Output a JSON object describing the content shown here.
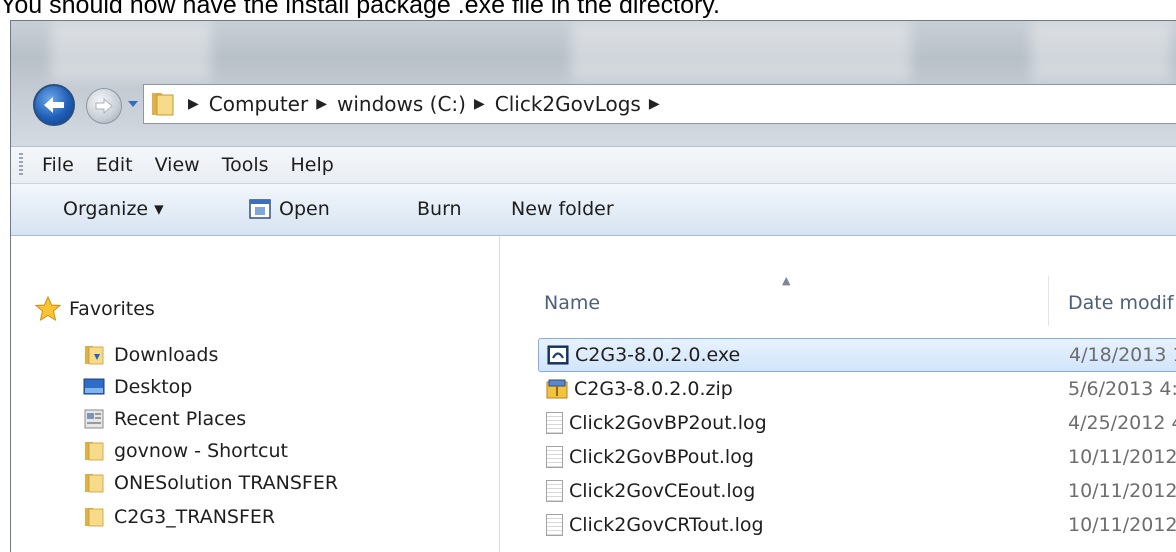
{
  "caption": "You should now have the install package .exe file in the directory.",
  "address": {
    "crumbs": [
      "Computer",
      "windows (C:)",
      "Click2GovLogs"
    ]
  },
  "menu": [
    "File",
    "Edit",
    "View",
    "Tools",
    "Help"
  ],
  "toolbar": {
    "organize": "Organize ▾",
    "open": "Open",
    "burn": "Burn",
    "new_folder": "New folder"
  },
  "nav": {
    "favorites": "Favorites",
    "items": [
      "Downloads",
      "Desktop",
      "Recent Places",
      "govnow - Shortcut",
      "ONESolution TRANSFER",
      "C2G3_TRANSFER"
    ]
  },
  "columns": {
    "name": "Name",
    "date": "Date modif"
  },
  "files": [
    {
      "name": "C2G3-8.0.2.0.exe",
      "date": "4/18/2013 1",
      "icon": "installer-icon",
      "selected": true
    },
    {
      "name": "C2G3-8.0.2.0.zip",
      "date": "5/6/2013 4:",
      "icon": "zip-icon",
      "selected": false
    },
    {
      "name": "Click2GovBP2out.log",
      "date": "4/25/2012 4",
      "icon": "text-file-icon",
      "selected": false
    },
    {
      "name": "Click2GovBPout.log",
      "date": "10/11/2012",
      "icon": "text-file-icon",
      "selected": false
    },
    {
      "name": "Click2GovCEout.log",
      "date": "10/11/2012",
      "icon": "text-file-icon",
      "selected": false
    },
    {
      "name": "Click2GovCRTout.log",
      "date": "10/11/2012",
      "icon": "text-file-icon",
      "selected": false
    }
  ]
}
